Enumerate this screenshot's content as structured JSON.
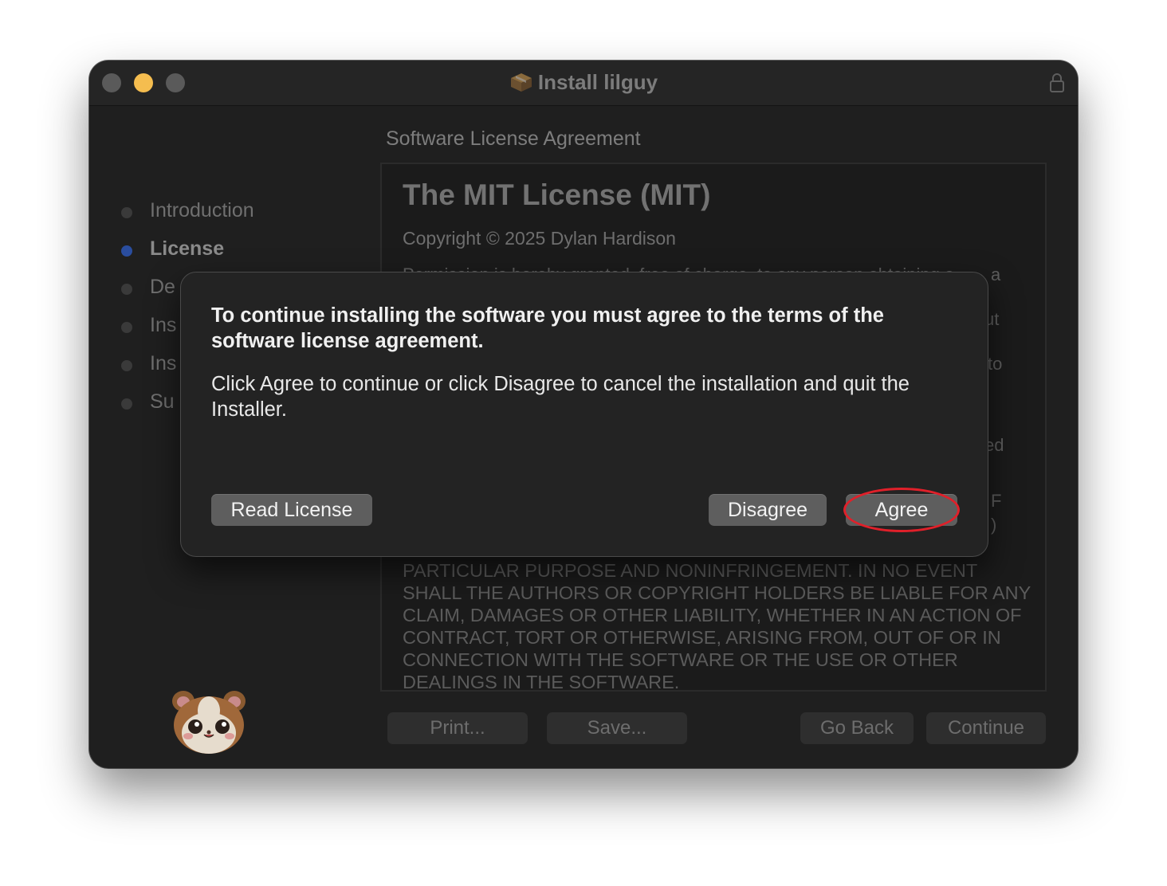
{
  "window": {
    "title": "Install lilguy",
    "accent_color": "#2a4d9e",
    "traffic_lights": [
      "close",
      "minimize",
      "zoom"
    ]
  },
  "sidebar": {
    "steps": [
      {
        "label": "Introduction",
        "state": "done"
      },
      {
        "label": "License",
        "state": "current"
      },
      {
        "label": "De",
        "state": "pending"
      },
      {
        "label": "Ins",
        "state": "pending"
      },
      {
        "label": "Ins",
        "state": "pending"
      },
      {
        "label": "Su",
        "state": "pending"
      }
    ]
  },
  "main": {
    "heading": "Software License Agreement",
    "license": {
      "title": "The MIT License (MIT)",
      "copyright": "Copyright © 2025 Dylan Hardison",
      "permission_partial": "Permission is hereby granted, free of charge, to any person obtaining a",
      "fragments": [
        "a",
        "ut",
        "to",
        "ed",
        "F",
        ")"
      ],
      "warranty_text": "PARTICULAR PURPOSE AND NONINFRINGEMENT. IN NO EVENT SHALL THE AUTHORS OR COPYRIGHT HOLDERS BE LIABLE FOR ANY CLAIM, DAMAGES OR OTHER LIABILITY, WHETHER IN AN ACTION OF CONTRACT, TORT OR OTHERWISE, ARISING FROM, OUT OF OR IN CONNECTION WITH THE SOFTWARE OR THE USE OR OTHER DEALINGS IN THE SOFTWARE."
    }
  },
  "footer": {
    "print_label": "Print...",
    "save_label": "Save...",
    "go_back_label": "Go Back",
    "continue_label": "Continue"
  },
  "dialog": {
    "title": "To continue installing the software you must agree to the terms of the software license agreement.",
    "body": "Click Agree to continue or click Disagree to cancel the installation and quit the Installer.",
    "read_license_label": "Read License",
    "disagree_label": "Disagree",
    "agree_label": "Agree",
    "highlight_color": "#e0202a"
  },
  "icons": [
    "package-icon",
    "lock-icon",
    "hamster-logo-icon"
  ]
}
